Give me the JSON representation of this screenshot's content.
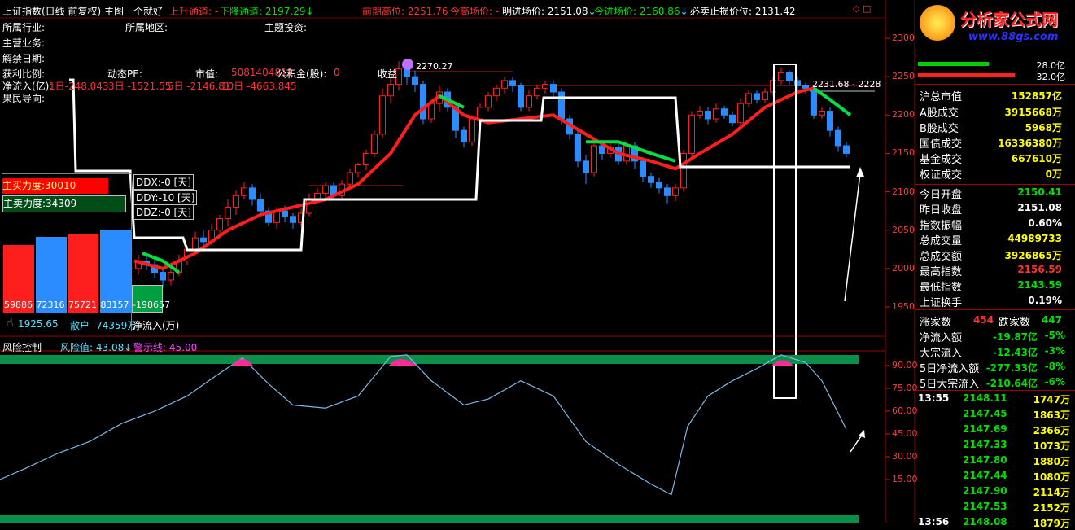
{
  "title_bar": {
    "index_name": "上证指数(日线 前复权)",
    "main_chart_label": "主图一个就好",
    "up_channel_label": "上升通道:",
    "up_channel_value": "-",
    "down_channel_label": "下降通道:",
    "down_channel_value": "2197.29",
    "prev_high_label": "前期高位:",
    "prev_high_value": "2251.76",
    "today_high_label": "今高场价:",
    "today_high_value": "-",
    "tomorrow_entry_label": "明进场价:",
    "tomorrow_entry_value": "2151.08",
    "today_entry_label": "今进场价:",
    "today_entry_value": "2160.86",
    "stop_loss_label": "必卖止损价位:",
    "stop_loss_value": "2131.42",
    "down_arrow": "↓"
  },
  "info_lines": {
    "industry": "所属行业:",
    "region": "所属地区:",
    "theme": "主题投资:",
    "business": "主营业务:",
    "unlock_date": "解禁日期:",
    "profit_ratio": "获利比例:",
    "dynamic_pe": "动态PE:",
    "market_cap_label": "市值:",
    "market_cap_value": "5081404811",
    "fund_label": "公积金(股):",
    "fund_value": "0",
    "income_label": "收益",
    "net_inflow_label": "净流入(亿):",
    "net_inflow_1d": "1日-248.043",
    "net_inflow_3d": "3日 -1521.55",
    "net_inflow_5d": "5日 -2146.81",
    "net_inflow_10d": "10日 -4663.845",
    "guide_label": "果民导向:"
  },
  "price_annotations": {
    "peak_label": "2270.27",
    "right_label": "2231.68 - 2228"
  },
  "power_panel": {
    "buy_power_label": "主买力度:30010",
    "sell_power_label": "主卖力度:34309",
    "ddx_label": "DDX:-0",
    "ddy_label": "DDY:-10",
    "ddz_label": "DDZ:-0",
    "days_suffix": "[天]",
    "bars": [
      {
        "label": "59886",
        "value": 59886,
        "color": "#ff1e1e"
      },
      {
        "label": "72316",
        "value": 72316,
        "color": "#2a8cff"
      },
      {
        "label": "75721",
        "value": 75721,
        "color": "#ff1e1e"
      },
      {
        "label": "83157",
        "value": 83157,
        "color": "#2a8cff"
      },
      {
        "label": "-198657",
        "value": -198657,
        "color": "#00a040"
      }
    ],
    "bottom_line": "1925.65",
    "retail_label": "散户 -74359万",
    "net_in_label": "净流入(万)"
  },
  "price_axis": [
    "2300",
    "2250",
    "2200",
    "2150",
    "2100",
    "2050",
    "2000",
    "1950"
  ],
  "risk_panel": {
    "name": "风险控制",
    "value_label": "风险值:",
    "value": "43.08",
    "warn_label": "警示线:",
    "warn_value": "45.00",
    "axis": [
      "90.00",
      "75.00",
      "60.00",
      "45.00",
      "30.00",
      "15.00"
    ]
  },
  "logo": {
    "text": "分析家公式网",
    "url_text": "www.88gs.com"
  },
  "right_panel": {
    "volume_bars": [
      {
        "label": "28.0亿",
        "fill": 0.62,
        "color": "#00d000"
      },
      {
        "label": "32.0亿",
        "fill": 0.85,
        "color": "#ff2020"
      }
    ],
    "market_value_label": "沪总市值",
    "market_value": "152857亿",
    "turnover": [
      {
        "label": "A股成交",
        "value": "3915668万"
      },
      {
        "label": "B股成交",
        "value": "5968万"
      },
      {
        "label": "国债成交",
        "value": "16336380万"
      },
      {
        "label": "基金成交",
        "value": "667610万"
      },
      {
        "label": "权证成交",
        "value": "0万"
      }
    ],
    "stats": [
      {
        "label": "今日开盘",
        "value": "2150.41",
        "color": "#00e000"
      },
      {
        "label": "昨日收盘",
        "value": "2151.08",
        "color": "#ffffff"
      },
      {
        "label": "指数振幅",
        "value": "0.60%",
        "color": "#ffffff"
      },
      {
        "label": "总成交量",
        "value": "44989733",
        "color": "#ffff00"
      },
      {
        "label": "总成交额",
        "value": "3926865万",
        "color": "#ffff00"
      },
      {
        "label": "最高指数",
        "value": "2156.59",
        "color": "#ff3232"
      },
      {
        "label": "最低指数",
        "value": "2143.59",
        "color": "#00e000"
      },
      {
        "label": "上证换手",
        "value": "0.19%",
        "color": "#ffffff"
      }
    ],
    "adv_label": "涨家数",
    "adv_value": "454",
    "dec_label": "跌家数",
    "dec_value": "447",
    "flows": [
      {
        "label": "净流入额",
        "value": "-19.87亿",
        "pct": "-5%"
      },
      {
        "label": "大宗流入",
        "value": "-12.43亿",
        "pct": "-3%"
      },
      {
        "label": "5日净流入额",
        "value": "-277.33亿",
        "pct": "-8%"
      },
      {
        "label": "5日大宗流入",
        "value": "-210.64亿",
        "pct": "-6%"
      }
    ],
    "ticks": [
      {
        "time": "13:55",
        "price": "2148.11",
        "vol": "1747万"
      },
      {
        "time": "",
        "price": "2147.45",
        "vol": "1863万"
      },
      {
        "time": "",
        "price": "2147.69",
        "vol": "2366万"
      },
      {
        "time": "",
        "price": "2147.33",
        "vol": "1073万"
      },
      {
        "time": "",
        "price": "2147.80",
        "vol": "1880万"
      },
      {
        "time": "",
        "price": "2147.44",
        "vol": "1080万"
      },
      {
        "time": "",
        "price": "2147.90",
        "vol": "2114万"
      },
      {
        "time": "",
        "price": "2147.53",
        "vol": "2152万"
      },
      {
        "time": "13:56",
        "price": "2148.08",
        "vol": "1879万"
      }
    ]
  },
  "candles": [
    [
      160,
      1985,
      2000,
      1978,
      2010
    ],
    [
      170,
      2000,
      2010,
      1992,
      2018
    ],
    [
      180,
      2010,
      2005,
      1998,
      2018
    ],
    [
      190,
      2005,
      1995,
      1988,
      2012
    ],
    [
      200,
      1995,
      1985,
      1975,
      2000
    ],
    [
      210,
      1985,
      1995,
      1978,
      2002
    ],
    [
      220,
      1995,
      2010,
      1990,
      2018
    ],
    [
      230,
      2010,
      2025,
      2005,
      2030
    ],
    [
      240,
      2025,
      2040,
      2020,
      2048
    ],
    [
      250,
      2040,
      2035,
      2028,
      2050
    ],
    [
      260,
      2035,
      2050,
      2030,
      2058
    ],
    [
      270,
      2050,
      2065,
      2045,
      2070
    ],
    [
      280,
      2065,
      2080,
      2055,
      2090
    ],
    [
      290,
      2080,
      2095,
      2070,
      2102
    ],
    [
      300,
      2095,
      2105,
      2090,
      2112
    ],
    [
      310,
      2105,
      2090,
      2082,
      2110
    ],
    [
      320,
      2090,
      2075,
      2068,
      2098
    ],
    [
      330,
      2075,
      2060,
      2055,
      2080
    ],
    [
      340,
      2060,
      2075,
      2052,
      2080
    ],
    [
      350,
      2075,
      2068,
      2060,
      2082
    ],
    [
      360,
      2068,
      2060,
      2052,
      2072
    ],
    [
      370,
      2060,
      2072,
      2055,
      2078
    ],
    [
      380,
      2072,
      2090,
      2068,
      2098
    ],
    [
      390,
      2090,
      2098,
      2085,
      2105
    ],
    [
      400,
      2098,
      2108,
      2092,
      2112
    ],
    [
      410,
      2108,
      2095,
      2090,
      2112
    ],
    [
      420,
      2095,
      2110,
      2090,
      2115
    ],
    [
      430,
      2110,
      2125,
      2105,
      2130
    ],
    [
      440,
      2125,
      2135,
      2118,
      2138
    ],
    [
      450,
      2135,
      2150,
      2128,
      2155
    ],
    [
      460,
      2150,
      2175,
      2145,
      2180
    ],
    [
      470,
      2175,
      2225,
      2170,
      2235
    ],
    [
      480,
      2225,
      2240,
      2215,
      2248
    ],
    [
      490,
      2240,
      2260,
      2232,
      2270
    ],
    [
      500,
      2260,
      2250,
      2240,
      2265
    ],
    [
      510,
      2250,
      2240,
      2230,
      2258
    ],
    [
      520,
      2240,
      2195,
      2188,
      2245
    ],
    [
      530,
      2195,
      2215,
      2190,
      2220
    ],
    [
      540,
      2215,
      2230,
      2205,
      2238
    ],
    [
      550,
      2230,
      2210,
      2205,
      2235
    ],
    [
      560,
      2210,
      2180,
      2170,
      2215
    ],
    [
      570,
      2180,
      2165,
      2158,
      2185
    ],
    [
      580,
      2165,
      2195,
      2160,
      2200
    ],
    [
      590,
      2195,
      2210,
      2190,
      2215
    ],
    [
      600,
      2210,
      2225,
      2205,
      2230
    ],
    [
      610,
      2225,
      2235,
      2218,
      2240
    ],
    [
      620,
      2235,
      2245,
      2228,
      2250
    ],
    [
      630,
      2245,
      2238,
      2230,
      2250
    ],
    [
      640,
      2238,
      2210,
      2205,
      2242
    ],
    [
      650,
      2210,
      2225,
      2205,
      2232
    ],
    [
      660,
      2225,
      2235,
      2220,
      2240
    ],
    [
      670,
      2235,
      2240,
      2228,
      2245
    ],
    [
      680,
      2240,
      2230,
      2222,
      2245
    ],
    [
      690,
      2230,
      2195,
      2188,
      2235
    ],
    [
      700,
      2195,
      2175,
      2168,
      2200
    ],
    [
      710,
      2175,
      2140,
      2132,
      2180
    ],
    [
      720,
      2140,
      2125,
      2110,
      2148
    ],
    [
      730,
      2125,
      2160,
      2120,
      2168
    ],
    [
      740,
      2160,
      2150,
      2142,
      2165
    ],
    [
      750,
      2150,
      2158,
      2145,
      2165
    ],
    [
      760,
      2158,
      2140,
      2135,
      2162
    ],
    [
      770,
      2140,
      2160,
      2135,
      2165
    ],
    [
      780,
      2160,
      2140,
      2130,
      2165
    ],
    [
      790,
      2140,
      2120,
      2112,
      2145
    ],
    [
      800,
      2120,
      2112,
      2105,
      2125
    ],
    [
      810,
      2112,
      2105,
      2098,
      2118
    ],
    [
      820,
      2105,
      2095,
      2085,
      2110
    ],
    [
      830,
      2095,
      2105,
      2088,
      2110
    ],
    [
      840,
      2105,
      2150,
      2100,
      2155
    ],
    [
      850,
      2150,
      2200,
      2145,
      2205
    ],
    [
      860,
      2200,
      2205,
      2195,
      2212
    ],
    [
      870,
      2205,
      2195,
      2188,
      2210
    ],
    [
      880,
      2195,
      2208,
      2190,
      2215
    ],
    [
      890,
      2208,
      2200,
      2195,
      2212
    ],
    [
      900,
      2200,
      2190,
      2185,
      2205
    ],
    [
      910,
      2190,
      2215,
      2185,
      2222
    ],
    [
      920,
      2215,
      2228,
      2210,
      2232
    ],
    [
      930,
      2228,
      2220,
      2215,
      2232
    ],
    [
      940,
      2220,
      2230,
      2215,
      2235
    ],
    [
      950,
      2230,
      2245,
      2225,
      2250
    ],
    [
      960,
      2245,
      2255,
      2240,
      2262
    ],
    [
      970,
      2255,
      2245,
      2240,
      2258
    ],
    [
      980,
      2245,
      2238,
      2232,
      2250
    ],
    [
      990,
      2238,
      2235,
      2228,
      2242
    ],
    [
      1000,
      2235,
      2200,
      2195,
      2238
    ],
    [
      1010,
      2200,
      2205,
      2195,
      2210
    ],
    [
      1020,
      2205,
      2180,
      2172,
      2210
    ],
    [
      1030,
      2180,
      2160,
      2152,
      2185
    ],
    [
      1040,
      2160,
      2150,
      2145,
      2165
    ]
  ],
  "ma_line": [
    [
      165,
      2010
    ],
    [
      200,
      2000
    ],
    [
      240,
      2020
    ],
    [
      280,
      2050
    ],
    [
      320,
      2070
    ],
    [
      360,
      2080
    ],
    [
      400,
      2090
    ],
    [
      440,
      2110
    ],
    [
      480,
      2150
    ],
    [
      510,
      2200
    ],
    [
      540,
      2225
    ],
    [
      570,
      2200
    ],
    [
      600,
      2190
    ],
    [
      640,
      2195
    ],
    [
      680,
      2200
    ],
    [
      720,
      2175
    ],
    [
      760,
      2150
    ],
    [
      800,
      2140
    ],
    [
      830,
      2130
    ],
    [
      860,
      2150
    ],
    [
      900,
      2175
    ],
    [
      940,
      2210
    ],
    [
      980,
      2230
    ],
    [
      1000,
      2235
    ]
  ],
  "green_segments": [
    [
      [
        175,
        2020
      ],
      [
        200,
        2010
      ],
      [
        220,
        1995
      ]
    ],
    [
      [
        540,
        2225
      ],
      [
        570,
        2210
      ]
    ],
    [
      [
        720,
        2165
      ],
      [
        760,
        2165
      ],
      [
        800,
        2150
      ],
      [
        830,
        2140
      ]
    ],
    [
      [
        1000,
        2235
      ],
      [
        1020,
        2220
      ],
      [
        1045,
        2200
      ]
    ]
  ],
  "risk_line": [
    [
      0,
      15
    ],
    [
      30,
      22
    ],
    [
      70,
      32
    ],
    [
      110,
      40
    ],
    [
      150,
      52
    ],
    [
      190,
      60
    ],
    [
      230,
      70
    ],
    [
      270,
      85
    ],
    [
      298,
      95
    ],
    [
      330,
      78
    ],
    [
      360,
      64
    ],
    [
      400,
      62
    ],
    [
      440,
      70
    ],
    [
      480,
      96
    ],
    [
      500,
      97
    ],
    [
      530,
      80
    ],
    [
      570,
      64
    ],
    [
      600,
      68
    ],
    [
      640,
      80
    ],
    [
      680,
      70
    ],
    [
      720,
      40
    ],
    [
      760,
      25
    ],
    [
      800,
      12
    ],
    [
      825,
      5
    ],
    [
      845,
      50
    ],
    [
      870,
      70
    ],
    [
      900,
      80
    ],
    [
      930,
      88
    ],
    [
      960,
      97
    ],
    [
      990,
      92
    ],
    [
      1010,
      80
    ],
    [
      1040,
      48
    ]
  ]
}
